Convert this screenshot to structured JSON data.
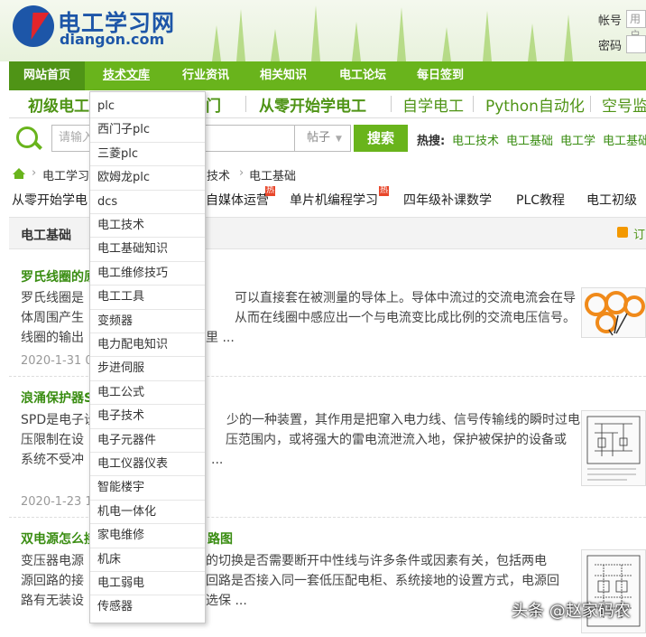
{
  "header": {
    "logo_cn": "电工学习网",
    "logo_en": "diangon.com",
    "account_label": "帐号",
    "account_placeholder": "用户",
    "password_label": "密码"
  },
  "nav": {
    "items": [
      "网站首页",
      "技术文库",
      "行业资讯",
      "相关知识",
      "电工论坛",
      "每日签到"
    ]
  },
  "subnav": {
    "items": [
      "初级电工",
      "门",
      "从零开始学电工",
      "自学电工",
      "Python自动化",
      "空号监"
    ]
  },
  "search": {
    "placeholder": "请输入",
    "type_label": "帖子",
    "button_label": "搜索",
    "hot_label": "热搜:",
    "hot_links": [
      "电工技术",
      "电工基础",
      "电工学",
      "电工基础"
    ]
  },
  "breadcrumb": [
    "电工学习",
    "技术",
    "电工基础"
  ],
  "tags": [
    {
      "label": "从零开始学电",
      "hot": false
    },
    {
      "label": "自媒体运营",
      "hot": true
    },
    {
      "label": "单片机编程学习",
      "hot": true
    },
    {
      "label": "四年级补课数学",
      "hot": false
    },
    {
      "label": "PLC教程",
      "hot": false
    },
    {
      "label": "电工初级",
      "hot": false
    }
  ],
  "hot_badge": "热",
  "section": {
    "title": "电工基础",
    "rss_label": "订"
  },
  "articles": [
    {
      "title": "罗氏线圈的原",
      "lines": [
        "罗氏线圈是",
        "可以直接套在被测量的导体上。导体中流过的交流电流会在导",
        "体周围产生",
        "从而在线圈中感应出一个与电流变比成比例的交流电压信号。",
        "线圈的输出",
        "里 ..."
      ],
      "date": "2020-1-31 09"
    },
    {
      "title": "浪涌保护器S",
      "lines": [
        "SPD是电子设",
        "少的一种装置，其作用是把窜入电力线、信号传输线的瞬时过电",
        "压限制在设",
        "压范围内，或将强大的雷电流泄流入地，保护被保护的设备或",
        "系统不受冲",
        "..."
      ],
      "date": "2020-1-23 17"
    },
    {
      "title": "双电源怎么接",
      "title_tail": "路图",
      "lines": [
        "变压器电源",
        "的切换是否需要断开中性线与许多条件或因素有关，包括两电",
        "源回路的接",
        "回路是否接入同一套低压配电柜、系统接地的设置方式，电源回",
        "路有无装设",
        "选保 ..."
      ]
    }
  ],
  "dropdown": {
    "items": [
      "plc",
      "西门子plc",
      "三菱plc",
      "欧姆龙plc",
      "dcs",
      "电工技术",
      "电工基础知识",
      "电工维修技巧",
      "电工工具",
      "变频器",
      "电力配电知识",
      "步进伺服",
      "电工公式",
      "电子技术",
      "电子元器件",
      "电工仪器仪表",
      "智能楼宇",
      "机电一体化",
      "家电维修",
      "机床",
      "电工弱电",
      "传感器"
    ]
  },
  "watermark": "头条 @赵家码农",
  "colors": {
    "brand_green": "#69b41c",
    "title_green": "#3a8d12",
    "logo_blue": "#1d56a8"
  }
}
